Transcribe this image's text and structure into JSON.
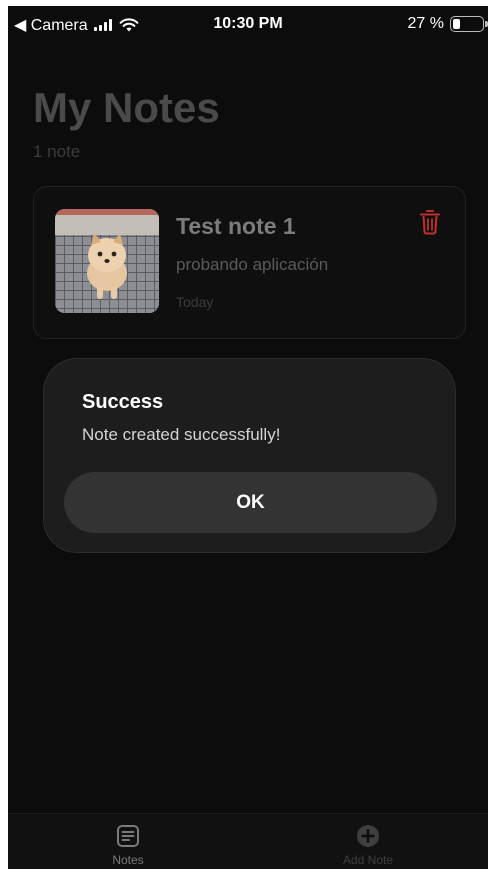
{
  "status_bar": {
    "back_label": "◀ Camera",
    "time": "10:30 PM",
    "battery_text": "27 %",
    "battery_level": 0.27
  },
  "header": {
    "title": "My Notes",
    "count_text": "1 note"
  },
  "notes": [
    {
      "title": "Test note 1",
      "body": "probando aplicación",
      "date": "Today",
      "thumbnail_icon": "dog-photo"
    }
  ],
  "alert": {
    "title": "Success",
    "message": "Note created successfully!",
    "ok_label": "OK"
  },
  "tab_bar": {
    "tabs": [
      {
        "label": "Notes",
        "icon": "notes-icon",
        "active": true
      },
      {
        "label": "Add Note",
        "icon": "add-circle-icon",
        "active": false
      }
    ]
  },
  "colors": {
    "background": "#0c0c0c",
    "delete_accent": "#c0302b",
    "dialog": "#1d1d1d",
    "dialog_button": "#333333"
  }
}
